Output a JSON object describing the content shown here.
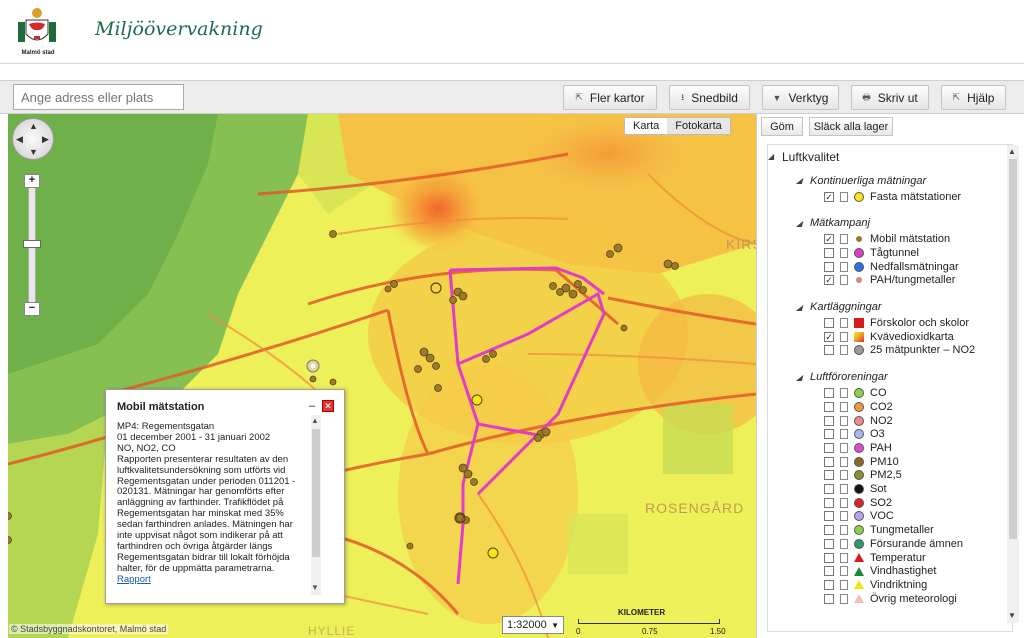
{
  "header": {
    "logo_caption": "Malmö stad",
    "title": "Miljöövervakning"
  },
  "toolbar": {
    "search_placeholder": "Ange adress eller plats",
    "buttons": {
      "fler_kartor": "Fler kartor",
      "snedbild": "Snedbild",
      "verktyg": "Verktyg",
      "skriv_ut": "Skriv ut",
      "hjalp": "Hjälp"
    }
  },
  "map": {
    "type_karta": "Karta",
    "type_fotokarta": "Fotokarta",
    "labels": {
      "kirs": "KIRS",
      "rosengard": "ROSENGÅRD",
      "hyllie": "HYLLIE"
    },
    "copyright": "© Stadsbyggnadskontoret, Malmö stad",
    "scale_value": "1:32000",
    "scalebar": {
      "unit": "KILOMETER",
      "t0": "0",
      "t1": "0.75",
      "t2": "1.50"
    }
  },
  "popup": {
    "title": "Mobil mätstation",
    "lines": [
      "MP4: Regementsgatan",
      "01 december 2001 - 31 januari 2002",
      "NO, NO2, CO",
      "Rapporten presenterar resultaten av den",
      "luftkvalitetsundersökning som utförts vid",
      "Regementsgatan under perioden 011201 -",
      "020131. Mätningar har genomförts efter",
      "anläggning av farthinder. Trafikflödet på",
      "Regementsgatan har minskat med 35%",
      "sedan farthindren anlades. Mätningen har",
      "inte uppvisat något som indikerar på att",
      "farthindren och övriga åtgärder längs",
      "Regementsgatan bidrar till lokalt förhöjda",
      "halter, för de uppmätta parametrarna."
    ],
    "link": "Rapport"
  },
  "panel": {
    "gom": "Göm",
    "slack": "Släck alla lager",
    "root": "Luftkvalitet",
    "groups": [
      {
        "name": "Kontinuerliga mätningar",
        "items": [
          {
            "label": "Fasta mätstationer",
            "checked": true,
            "color": "#f5e614",
            "shape": "circ"
          }
        ]
      },
      {
        "name": "Mätkampanj",
        "items": [
          {
            "label": "Mobil mätstation",
            "checked": true,
            "color": "#9b7a2c",
            "shape": "dot"
          },
          {
            "label": "Tågtunnel",
            "checked": false,
            "color": "#e03cc8",
            "shape": "circ"
          },
          {
            "label": "Nedfallsmätningar",
            "checked": false,
            "color": "#2f6fe0",
            "shape": "circ"
          },
          {
            "label": "PAH/tungmetaller",
            "checked": true,
            "color": "#d9897a",
            "shape": "dot"
          }
        ]
      },
      {
        "name": "Kartläggningar",
        "items": [
          {
            "label": "Förskolor och skolor",
            "checked": false,
            "color": "#d41c1c",
            "shape": "square"
          },
          {
            "label": "Kvävedioxidkarta",
            "checked": true,
            "color": "#f0a030",
            "shape": "legend"
          },
          {
            "label": "25 mätpunkter – NO2",
            "checked": false,
            "color": "#9a9a9a",
            "shape": "circ"
          }
        ]
      },
      {
        "name": "Luftföroreningar",
        "items": [
          {
            "label": "CO",
            "checked": false,
            "color": "#8fd04a",
            "shape": "circ"
          },
          {
            "label": "CO2",
            "checked": false,
            "color": "#f29a3c",
            "shape": "circ"
          },
          {
            "label": "NO2",
            "checked": false,
            "color": "#f08a8a",
            "shape": "circ"
          },
          {
            "label": "O3",
            "checked": false,
            "color": "#a9b7f0",
            "shape": "circ"
          },
          {
            "label": "PAH",
            "checked": false,
            "color": "#e24ad0",
            "shape": "circ"
          },
          {
            "label": "PM10",
            "checked": false,
            "color": "#8a6a26",
            "shape": "circ"
          },
          {
            "label": "PM2,5",
            "checked": false,
            "color": "#8d8d2c",
            "shape": "circ"
          },
          {
            "label": "Sot",
            "checked": false,
            "color": "#111111",
            "shape": "circ"
          },
          {
            "label": "SO2",
            "checked": false,
            "color": "#e02222",
            "shape": "circ"
          },
          {
            "label": "VOC",
            "checked": false,
            "color": "#b4a4f0",
            "shape": "circ"
          },
          {
            "label": "Tungmetaller",
            "checked": false,
            "color": "#8fd04a",
            "shape": "circ"
          },
          {
            "label": "Försurande ämnen",
            "checked": false,
            "color": "#2a9a6a",
            "shape": "circ"
          },
          {
            "label": "Temperatur",
            "checked": false,
            "color": "#d41c1c",
            "shape": "tri"
          },
          {
            "label": "Vindhastighet",
            "checked": false,
            "color": "#1a8a3a",
            "shape": "tri"
          },
          {
            "label": "Vindriktning",
            "checked": false,
            "color": "#f2e21a",
            "shape": "tri"
          },
          {
            "label": "Övrig meteorologi",
            "checked": false,
            "color": "#f0c0b0",
            "shape": "tri"
          }
        ]
      }
    ]
  }
}
